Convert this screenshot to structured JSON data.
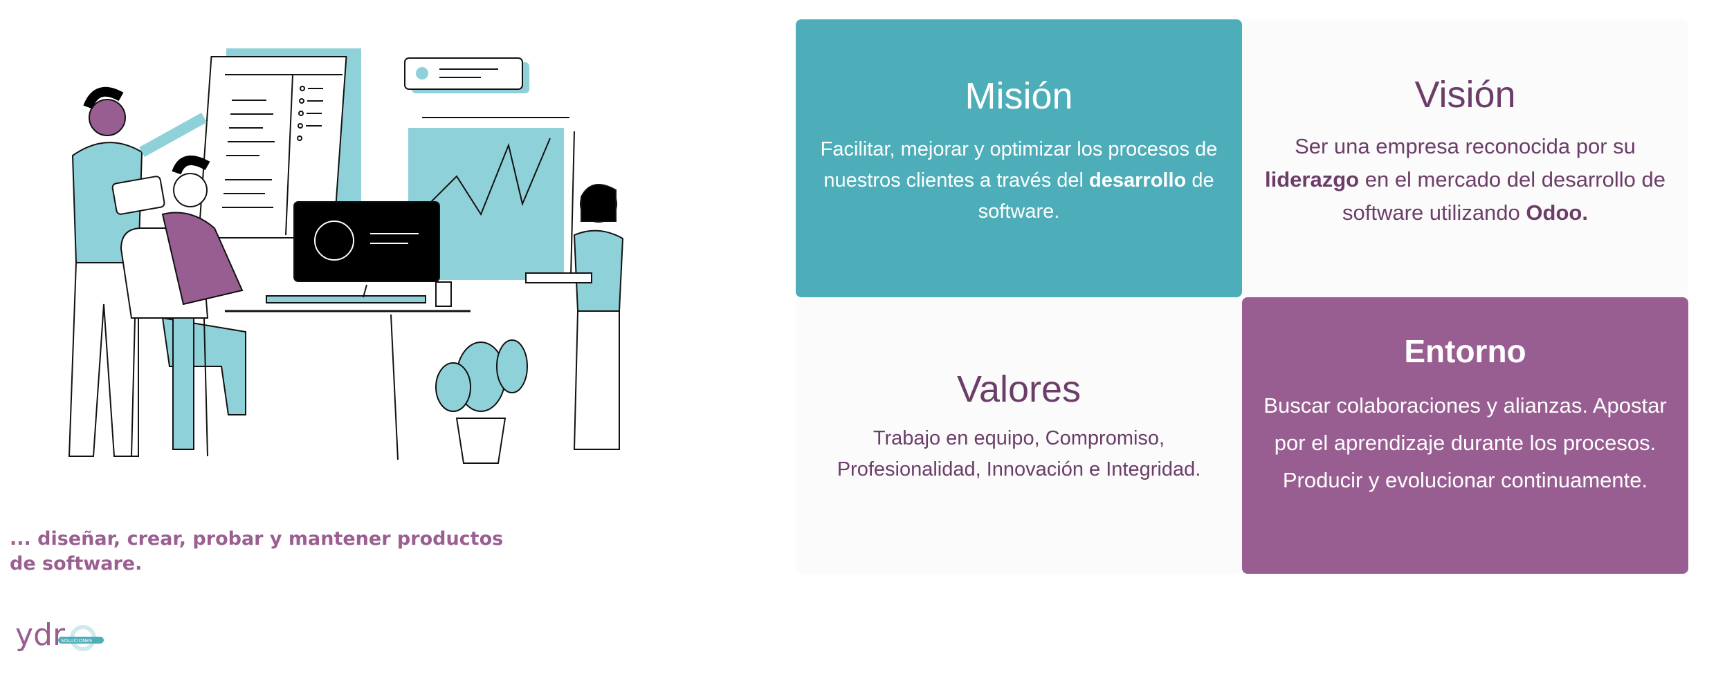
{
  "colors": {
    "teal": "#4dadb8",
    "purple": "#985e91",
    "dark_purple": "#6b3d68",
    "light_card": "#fbfbfb"
  },
  "tagline": "... diseñar, crear, probar y mantener productos de software.",
  "logo": {
    "brand": "ydr",
    "subtext": "SOLUCIONES"
  },
  "cards": {
    "mision": {
      "title": "Misión",
      "text_before": "Facilitar, mejorar y optimizar los procesos de nuestros clientes a través del ",
      "text_bold": "desarrollo",
      "text_after": " de software."
    },
    "vision": {
      "title": "Visión",
      "text_before": "Ser una empresa reconocida por su ",
      "text_bold_1": "liderazgo",
      "text_middle": " en el mercado del desarrollo de software utilizando ",
      "text_bold_2": "Odoo."
    },
    "valores": {
      "title": "Valores",
      "text": "Trabajo en equipo, Compromiso, Profesionalidad, Innovación e Integridad."
    },
    "entorno": {
      "title": "Entorno",
      "text": "Buscar colaboraciones y alianzas. Apostar por el aprendizaje durante los procesos. Producir y evolucionar continuamente."
    }
  }
}
